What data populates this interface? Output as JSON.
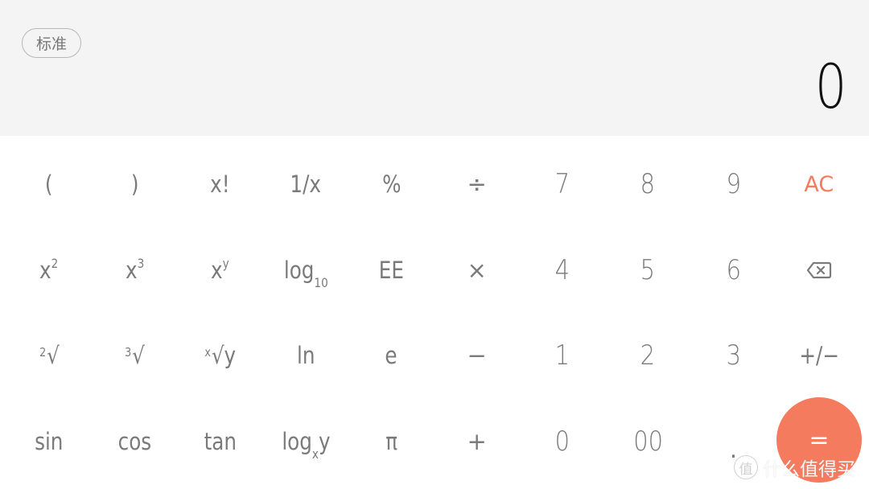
{
  "app": "Calculator",
  "header": {
    "mode_label": "标准",
    "display_value": "0"
  },
  "colors": {
    "accent": "#f47b5e",
    "display_bg": "#f4f4f4",
    "key_text": "#7a7a7a",
    "display_text": "#111111"
  },
  "keys": {
    "r1": {
      "lparen": "(",
      "rparen": ")",
      "factorial": "x!",
      "reciprocal": "1/x",
      "percent": "%",
      "divide": "÷",
      "seven": "7",
      "eight": "8",
      "nine": "9",
      "clear": "AC"
    },
    "r2": {
      "square_base": "x",
      "square_exp": "2",
      "cube_base": "x",
      "cube_exp": "3",
      "power_base": "x",
      "power_exp": "y",
      "log10_main": "log",
      "log10_sub": "10",
      "ee": "EE",
      "multiply": "×",
      "four": "4",
      "five": "5",
      "six": "6",
      "backspace_icon": "backspace-icon"
    },
    "r3": {
      "sqrt_index": "2",
      "sqrt_sym": "√",
      "cbrt_index": "3",
      "cbrt_sym": "√",
      "nroot_index": "x",
      "nroot_sym": "√y",
      "ln": "ln",
      "e": "e",
      "minus": "−",
      "one": "1",
      "two": "2",
      "three": "3",
      "negate": "+/−"
    },
    "r4": {
      "sin": "sin",
      "cos": "cos",
      "tan": "tan",
      "logxy_main": "log",
      "logxy_sub": "x",
      "logxy_tail": "y",
      "pi": "π",
      "plus": "+",
      "zero": "0",
      "double_zero": "00",
      "decimal": ".",
      "equals": "="
    }
  },
  "watermark": {
    "logo": "值",
    "text": "什么值得买"
  }
}
